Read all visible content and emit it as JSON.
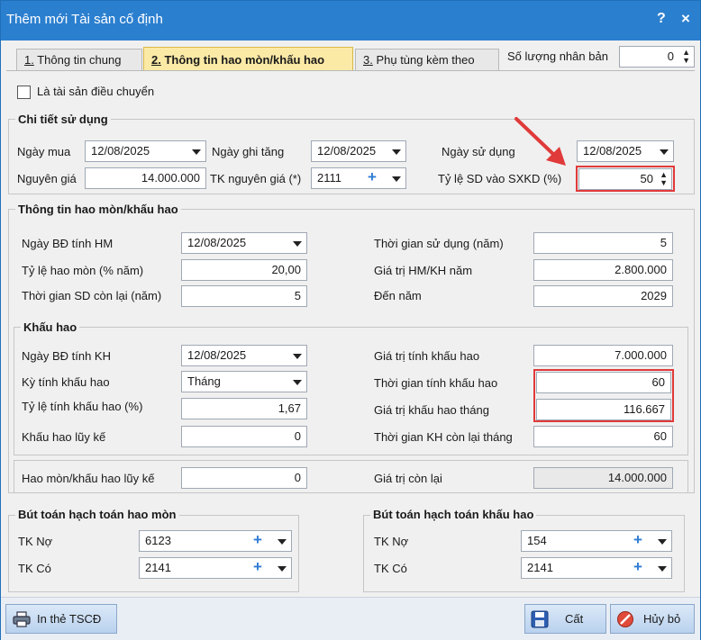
{
  "window": {
    "title": "Thêm mới Tài sản cố định",
    "help": "?",
    "close": "×"
  },
  "tabs": [
    {
      "num": "1.",
      "label": " Thông tin chung"
    },
    {
      "num": "2.",
      "label": " Thông tin hao mòn/khấu hao"
    },
    {
      "num": "3.",
      "label": " Phụ tùng kèm theo"
    }
  ],
  "clone": {
    "label": "Số lượng nhân bản",
    "value": "0"
  },
  "transfer_checkbox": {
    "label": "Là tài sản điều chuyển",
    "checked": false
  },
  "usage": {
    "title": "Chi tiết sử dụng",
    "purchase_date_label": "Ngày mua",
    "purchase_date": "12/08/2025",
    "record_date_label": "Ngày ghi tăng",
    "record_date": "12/08/2025",
    "use_date_label": "Ngày sử dụng",
    "use_date": "12/08/2025",
    "cost_label": "Nguyên giá",
    "cost": "14.000.000",
    "account_label": "TK nguyên giá (*)",
    "account": "2111",
    "ratio_label": "Tỷ lệ SD vào SXKD (%)",
    "ratio": "50"
  },
  "depreciation": {
    "title": "Thông tin hao mòn/khấu hao",
    "hm_start_label": "Ngày BĐ tính HM",
    "hm_start": "12/08/2025",
    "use_years_label": "Thời gian sử dụng (năm)",
    "use_years": "5",
    "hm_rate_label": "Tỷ lệ hao mòn (% năm)",
    "hm_rate": "20,00",
    "hm_year_value_label": "Giá trị HM/KH năm",
    "hm_year_value": "2.800.000",
    "remaining_years_label": "Thời gian SD còn lại (năm)",
    "remaining_years": "5",
    "until_year_label": "Đến năm",
    "until_year": "2029"
  },
  "amortization": {
    "title": "Khấu hao",
    "kh_start_label": "Ngày BĐ tính KH",
    "kh_start": "12/08/2025",
    "kh_value_label": "Giá trị tính khấu hao",
    "kh_value": "7.000.000",
    "period_label": "Kỳ tính khấu hao",
    "period": "Tháng",
    "kh_months_label": "Thời gian tính khấu hao",
    "kh_months": "60",
    "kh_rate_label": "Tỷ lệ tính khấu hao (%)",
    "kh_rate": "1,67",
    "kh_monthly_label": "Giá trị khấu hao tháng",
    "kh_monthly": "116.667",
    "accumulated_label": "Khấu hao lũy kế",
    "accumulated": "0",
    "kh_remaining_label": "Thời gian KH còn lại tháng",
    "kh_remaining": "60"
  },
  "totals": {
    "accum_label": "Hao mòn/khấu hao lũy kế",
    "accum": "0",
    "residual_label": "Giá trị còn lại",
    "residual": "14.000.000"
  },
  "entries_hm": {
    "title": "Bút toán hạch toán hao mòn",
    "debit_label": "TK Nợ",
    "debit": "6123",
    "credit_label": "TK Có",
    "credit": "2141"
  },
  "entries_kh": {
    "title": "Bút toán hạch toán khấu hao",
    "debit_label": "TK Nợ",
    "debit": "154",
    "credit_label": "TK Có",
    "credit": "2141"
  },
  "buttons": {
    "print": "In thẻ TSCĐ",
    "save": "Cất",
    "cancel": "Hủy bỏ"
  },
  "colors": {
    "title_bar": "#2b7fcf",
    "active_tab": "#fbe9a6",
    "highlight": "#e03a3a"
  }
}
